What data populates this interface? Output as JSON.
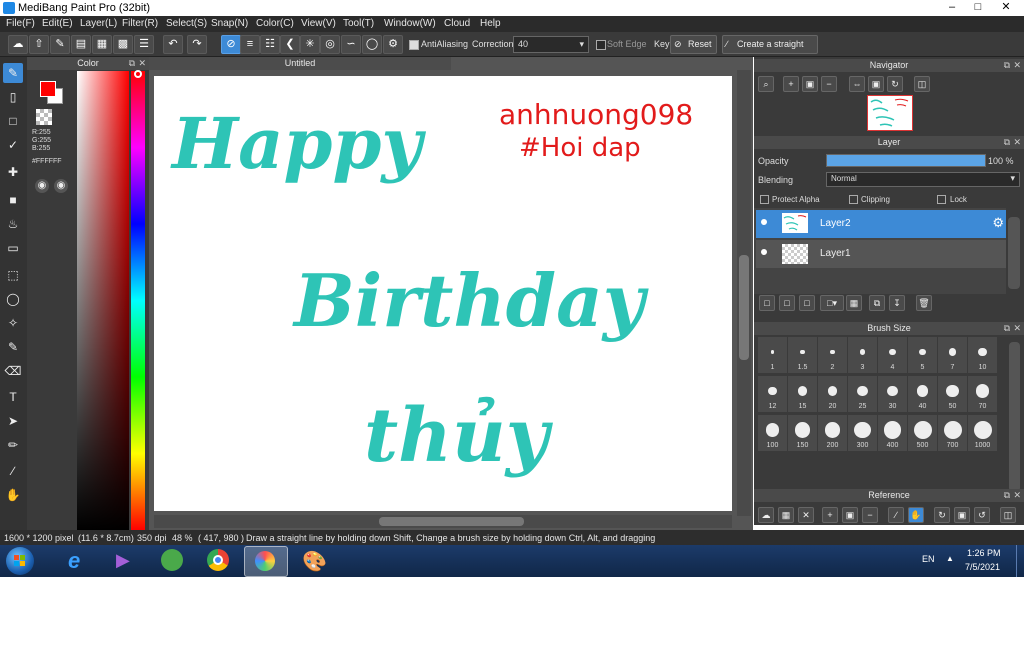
{
  "window": {
    "title": "MediBang Paint Pro (32bit)"
  },
  "menu": [
    "File(F)",
    "Edit(E)",
    "Layer(L)",
    "Filter(R)",
    "Select(S)",
    "Snap(N)",
    "Color(C)",
    "View(V)",
    "Tool(T)",
    "Window(W)",
    "Cloud",
    "Help"
  ],
  "toolbar": {
    "antialiasing_label": "AntiAliasing",
    "correction_label": "Correction",
    "correction_value": "40",
    "soft_edge_label": "Soft Edge",
    "key_label": "Key",
    "reset_label": "Reset",
    "straight_line_label": "Create a straight line"
  },
  "color_panel": {
    "title": "Color",
    "r": "R:255",
    "g": "G:255",
    "b": "B:255",
    "hex": "#FFFFFF",
    "fg_color": "#ff0000",
    "bg_color": "#ffffff"
  },
  "document": {
    "tab": "Untitled",
    "text_teal": {
      "line1": "Happy",
      "line2": "Birthday",
      "line3": "thủy",
      "color": "#2ec4b6"
    },
    "text_red": {
      "line1": "anhnuong098",
      "line2": "#Hoi dap",
      "color": "#e21b1b"
    }
  },
  "navigator": {
    "title": "Navigator"
  },
  "layer_panel": {
    "title": "Layer",
    "opacity_label": "Opacity",
    "opacity_value": "100 %",
    "opacity_fraction": 1.0,
    "blending_label": "Blending",
    "blending_value": "Normal",
    "protect_alpha": "Protect Alpha",
    "clipping": "Clipping",
    "lock": "Lock",
    "layers": [
      {
        "name": "Layer2",
        "selected": true
      },
      {
        "name": "Layer1",
        "selected": false
      }
    ]
  },
  "brush_size": {
    "title": "Brush Size",
    "sizes": [
      "1",
      "1.5",
      "2",
      "3",
      "4",
      "5",
      "7",
      "10",
      "12",
      "15",
      "20",
      "25",
      "30",
      "40",
      "50",
      "70",
      "100",
      "150",
      "200",
      "300",
      "400",
      "500",
      "700",
      "1000"
    ]
  },
  "reference": {
    "title": "Reference"
  },
  "status": {
    "dimensions": "1600 * 1200 pixel",
    "physical": "(11.6 * 8.7cm)",
    "dpi": "350 dpi",
    "zoom": "48 %",
    "coords": "( 417, 980 )",
    "hint": "Draw a straight line by holding down Shift, Change a brush size by holding down Ctrl, Alt, and dragging"
  },
  "taskbar": {
    "lang": "EN",
    "time": "1:26 PM",
    "date": "7/5/2021"
  },
  "accent_color": "#3d8ad6"
}
